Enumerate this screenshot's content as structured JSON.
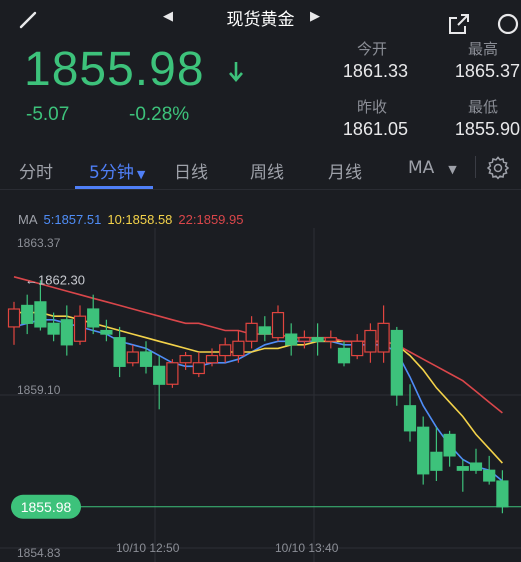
{
  "header": {
    "title": "现货黄金",
    "back_icon": "back-arrow-icon",
    "prev_icon": "triangle-left-icon",
    "next_icon": "triangle-right-icon",
    "share_icon": "share-icon",
    "search_icon": "search-icon"
  },
  "quote": {
    "price": "1855.98",
    "direction_icon": "arrow-down-icon",
    "change": "-5.07",
    "change_pct": "-0.28%",
    "color_down": "#3dc27b"
  },
  "stats": {
    "open_label": "今开",
    "open_value": "1861.33",
    "high_label": "最高",
    "high_value": "1865.37",
    "prev_close_label": "昨收",
    "prev_close_value": "1861.05",
    "low_label": "最低",
    "low_value": "1855.90"
  },
  "tabs": {
    "items": [
      "分时",
      "5分钟",
      "日线",
      "周线",
      "月线",
      "MA"
    ],
    "active": "5分钟",
    "settings_icon": "gear-icon"
  },
  "ma_legend": {
    "ma_label": "MA",
    "ma5": "5:1857.51",
    "ma10": "10:1858.58",
    "ma22": "22:1859.95",
    "ma5_color": "#4f8df7",
    "ma10_color": "#f3d24a",
    "ma22_color": "#d9464a"
  },
  "chart_data": {
    "type": "candlestick",
    "interval": "5分钟",
    "y_ticks": [
      "1863.37",
      "1859.10",
      "1854.83"
    ],
    "y_range": [
      1854.83,
      1863.37
    ],
    "max_marker": "1862.30",
    "current_price_tag": "1855.98",
    "x_labels": [
      "10/10 12:50",
      "10/10 13:40"
    ],
    "up_color": "#e0453f",
    "down_color": "#3dc27b",
    "candles": [
      {
        "o": 1861.0,
        "h": 1861.7,
        "l": 1860.5,
        "c": 1861.5
      },
      {
        "o": 1861.6,
        "h": 1861.9,
        "l": 1860.8,
        "c": 1861.1
      },
      {
        "o": 1861.7,
        "h": 1862.3,
        "l": 1860.9,
        "c": 1861.0
      },
      {
        "o": 1861.1,
        "h": 1861.4,
        "l": 1860.6,
        "c": 1860.8
      },
      {
        "o": 1861.2,
        "h": 1861.6,
        "l": 1860.2,
        "c": 1860.5
      },
      {
        "o": 1860.6,
        "h": 1861.6,
        "l": 1860.5,
        "c": 1861.3
      },
      {
        "o": 1861.5,
        "h": 1861.9,
        "l": 1860.8,
        "c": 1861.0
      },
      {
        "o": 1860.9,
        "h": 1861.2,
        "l": 1860.6,
        "c": 1860.8
      },
      {
        "o": 1860.7,
        "h": 1861.0,
        "l": 1859.6,
        "c": 1859.9
      },
      {
        "o": 1860.0,
        "h": 1860.5,
        "l": 1859.9,
        "c": 1860.3
      },
      {
        "o": 1860.3,
        "h": 1860.6,
        "l": 1859.7,
        "c": 1859.9
      },
      {
        "o": 1859.9,
        "h": 1860.2,
        "l": 1858.7,
        "c": 1859.4
      },
      {
        "o": 1859.4,
        "h": 1860.1,
        "l": 1859.3,
        "c": 1860.0
      },
      {
        "o": 1860.0,
        "h": 1860.3,
        "l": 1859.8,
        "c": 1860.2
      },
      {
        "o": 1859.7,
        "h": 1860.3,
        "l": 1859.6,
        "c": 1860.0
      },
      {
        "o": 1860.0,
        "h": 1860.4,
        "l": 1859.9,
        "c": 1860.2
      },
      {
        "o": 1860.2,
        "h": 1860.7,
        "l": 1860.0,
        "c": 1860.5
      },
      {
        "o": 1860.2,
        "h": 1860.9,
        "l": 1860.0,
        "c": 1860.6
      },
      {
        "o": 1860.6,
        "h": 1861.3,
        "l": 1860.4,
        "c": 1861.1
      },
      {
        "o": 1861.0,
        "h": 1861.3,
        "l": 1860.6,
        "c": 1860.8
      },
      {
        "o": 1860.7,
        "h": 1861.6,
        "l": 1860.6,
        "c": 1861.4
      },
      {
        "o": 1860.8,
        "h": 1861.1,
        "l": 1860.2,
        "c": 1860.5
      },
      {
        "o": 1860.6,
        "h": 1860.9,
        "l": 1860.4,
        "c": 1860.7
      },
      {
        "o": 1860.7,
        "h": 1861.1,
        "l": 1860.2,
        "c": 1860.6
      },
      {
        "o": 1860.6,
        "h": 1860.9,
        "l": 1860.4,
        "c": 1860.7
      },
      {
        "o": 1860.4,
        "h": 1860.6,
        "l": 1859.9,
        "c": 1860.0
      },
      {
        "o": 1860.2,
        "h": 1860.8,
        "l": 1860.1,
        "c": 1860.6
      },
      {
        "o": 1860.3,
        "h": 1861.1,
        "l": 1860.0,
        "c": 1860.9
      },
      {
        "o": 1860.3,
        "h": 1861.6,
        "l": 1860.0,
        "c": 1861.1
      },
      {
        "o": 1860.9,
        "h": 1861.0,
        "l": 1858.8,
        "c": 1859.1
      },
      {
        "o": 1858.8,
        "h": 1859.4,
        "l": 1857.8,
        "c": 1858.1
      },
      {
        "o": 1858.2,
        "h": 1858.5,
        "l": 1856.6,
        "c": 1856.9
      },
      {
        "o": 1857.5,
        "h": 1858.2,
        "l": 1856.7,
        "c": 1857.0
      },
      {
        "o": 1858.0,
        "h": 1858.1,
        "l": 1857.1,
        "c": 1857.4
      },
      {
        "o": 1857.1,
        "h": 1857.3,
        "l": 1856.4,
        "c": 1857.0
      },
      {
        "o": 1857.2,
        "h": 1857.6,
        "l": 1856.9,
        "c": 1857.0
      },
      {
        "o": 1857.0,
        "h": 1857.4,
        "l": 1856.6,
        "c": 1856.7
      },
      {
        "o": 1856.7,
        "h": 1857.0,
        "l": 1855.8,
        "c": 1855.98
      }
    ],
    "series": [
      {
        "name": "MA5",
        "values": [
          1861.0,
          1861.1,
          1861.2,
          1861.2,
          1861.1,
          1861.0,
          1860.9,
          1860.8,
          1860.6,
          1860.5,
          1860.4,
          1860.2,
          1860.0,
          1859.9,
          1859.9,
          1860.0,
          1860.0,
          1860.1,
          1860.3,
          1860.5,
          1860.6,
          1860.6,
          1860.6,
          1860.6,
          1860.6,
          1860.5,
          1860.5,
          1860.5,
          1860.5,
          1860.3,
          1859.6,
          1858.8,
          1858.2,
          1857.7,
          1857.3,
          1857.1,
          1857.0,
          1856.7
        ]
      },
      {
        "name": "MA10",
        "values": [
          1861.4,
          1861.4,
          1861.4,
          1861.3,
          1861.3,
          1861.2,
          1861.1,
          1861.0,
          1860.9,
          1860.8,
          1860.7,
          1860.6,
          1860.5,
          1860.4,
          1860.3,
          1860.3,
          1860.3,
          1860.3,
          1860.3,
          1860.4,
          1860.4,
          1860.5,
          1860.5,
          1860.6,
          1860.6,
          1860.6,
          1860.6,
          1860.6,
          1860.6,
          1860.5,
          1860.2,
          1859.8,
          1859.3,
          1858.9,
          1858.5,
          1858.0,
          1857.6,
          1857.2
        ]
      },
      {
        "name": "MA22",
        "values": [
          1862.4,
          1862.3,
          1862.2,
          1862.1,
          1862.0,
          1861.9,
          1861.8,
          1861.7,
          1861.6,
          1861.5,
          1861.4,
          1861.3,
          1861.2,
          1861.1,
          1861.1,
          1861.0,
          1860.9,
          1860.9,
          1860.8,
          1860.8,
          1860.8,
          1860.7,
          1860.7,
          1860.7,
          1860.7,
          1860.6,
          1860.6,
          1860.6,
          1860.6,
          1860.5,
          1860.3,
          1860.1,
          1859.9,
          1859.7,
          1859.5,
          1859.2,
          1858.9,
          1858.6
        ]
      }
    ]
  }
}
